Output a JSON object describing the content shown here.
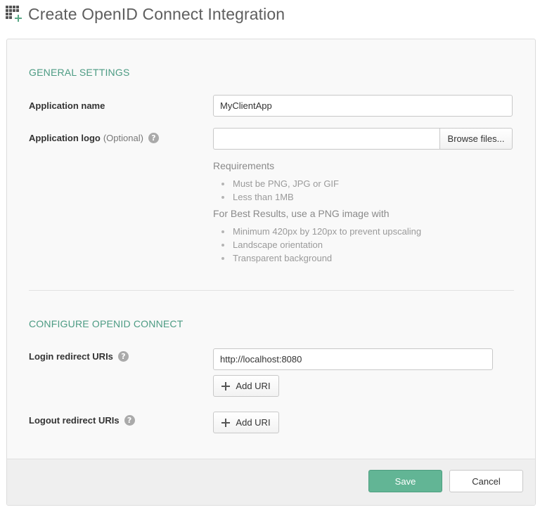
{
  "header": {
    "title": "Create OpenID Connect Integration",
    "icon": "app-grid-add-icon"
  },
  "general": {
    "section_title": "GENERAL SETTINGS",
    "app_name_label": "Application name",
    "app_name_value": "MyClientApp",
    "app_logo_label": "Application logo",
    "app_logo_optional": "(Optional)",
    "browse_label": "Browse files...",
    "requirements_heading": "Requirements",
    "requirements": [
      "Must be PNG, JPG or GIF",
      "Less than 1MB"
    ],
    "best_results_heading": "For Best Results, use a PNG image with",
    "best_results": [
      "Minimum 420px by 120px to prevent upscaling",
      "Landscape orientation",
      "Transparent background"
    ]
  },
  "oidc": {
    "section_title": "CONFIGURE OPENID CONNECT",
    "login_label": "Login redirect URIs",
    "login_value": "http://localhost:8080",
    "add_uri_label": "Add URI",
    "logout_label": "Logout redirect URIs"
  },
  "footer": {
    "save_label": "Save",
    "cancel_label": "Cancel"
  },
  "colors": {
    "accent": "#4c9b83",
    "save_button": "#62b595",
    "help_icon": "#aaaaaa"
  }
}
